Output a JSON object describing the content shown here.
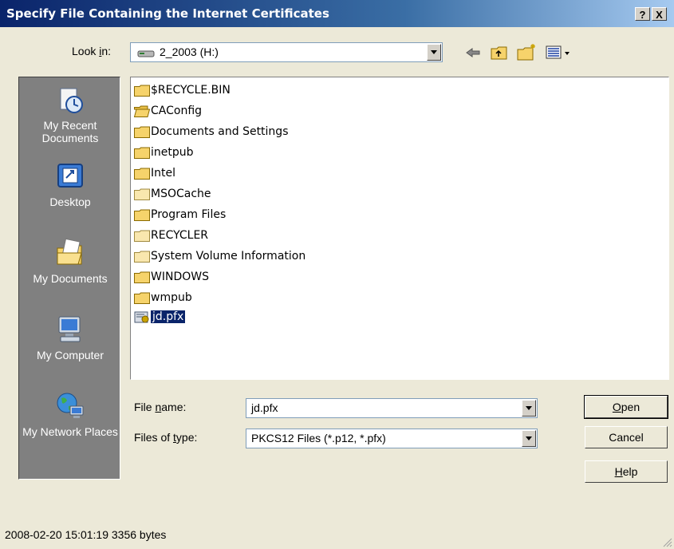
{
  "window": {
    "title": "Specify File Containing the Internet Certificates",
    "help_btn": "?",
    "close_btn": "X"
  },
  "toolbar": {
    "look_in_label_pre": "Look ",
    "look_in_label_u": "i",
    "look_in_label_post": "n:",
    "look_in_value": "2_2003 (H:)"
  },
  "places": [
    {
      "label": "My Recent Documents",
      "icon": "recent-documents-icon"
    },
    {
      "label": "Desktop",
      "icon": "desktop-icon"
    },
    {
      "label": "My Documents",
      "icon": "my-documents-icon"
    },
    {
      "label": "My Computer",
      "icon": "my-computer-icon"
    },
    {
      "label": "My Network Places",
      "icon": "network-places-icon"
    }
  ],
  "files": [
    {
      "name": "$RECYCLE.BIN",
      "type": "folder"
    },
    {
      "name": "CAConfig",
      "type": "folder-open"
    },
    {
      "name": "Documents and Settings",
      "type": "folder"
    },
    {
      "name": "inetpub",
      "type": "folder"
    },
    {
      "name": "Intel",
      "type": "folder"
    },
    {
      "name": "MSOCache",
      "type": "folder"
    },
    {
      "name": "Program Files",
      "type": "folder"
    },
    {
      "name": "RECYCLER",
      "type": "folder"
    },
    {
      "name": "System Volume Information",
      "type": "folder"
    },
    {
      "name": "WINDOWS",
      "type": "folder"
    },
    {
      "name": "wmpub",
      "type": "folder"
    },
    {
      "name": "jd.pfx",
      "type": "certificate",
      "selected": true
    }
  ],
  "form": {
    "file_name_label_pre": "File ",
    "file_name_label_u": "n",
    "file_name_label_post": "ame:",
    "file_name_value": "jd.pfx",
    "file_type_label_pre": "Files of ",
    "file_type_label_u": "t",
    "file_type_label_post": "ype:",
    "file_type_value": "PKCS12 Files (*.p12, *.pfx)"
  },
  "buttons": {
    "open_u": "O",
    "open_rest": "pen",
    "cancel": "Cancel",
    "help_u": "H",
    "help_rest": "elp"
  },
  "status": "2008-02-20 15:01:19 3356 bytes"
}
